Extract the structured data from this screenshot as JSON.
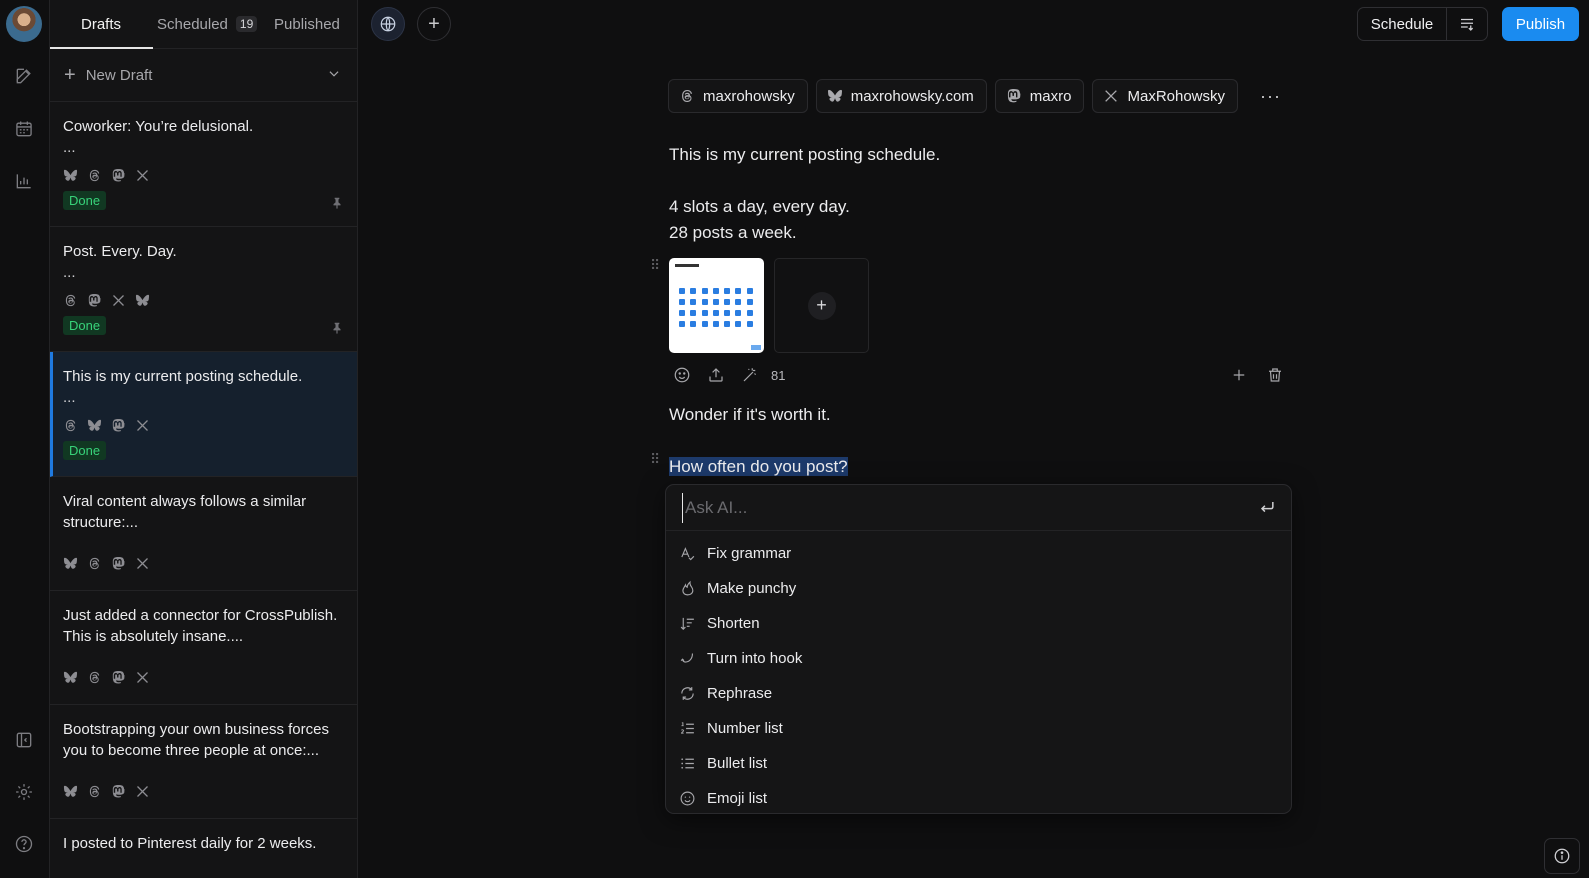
{
  "tabs": [
    {
      "label": "Drafts"
    },
    {
      "label": "Scheduled",
      "count": "19"
    },
    {
      "label": "Published"
    }
  ],
  "new_draft_label": "New Draft",
  "drafts": [
    {
      "title": "Coworker: You’re delusional.",
      "ellipsis": "...",
      "platforms": [
        "bluesky-icon",
        "threads-icon",
        "mastodon-icon",
        "x-icon"
      ],
      "status": "Done",
      "pinned": true
    },
    {
      "title": "Post. Every. Day.",
      "ellipsis": "...",
      "platforms": [
        "threads-icon",
        "mastodon-icon",
        "x-icon",
        "bluesky-icon"
      ],
      "status": "Done",
      "pinned": true
    },
    {
      "title": "This is my current posting schedule.",
      "ellipsis": "...",
      "platforms": [
        "threads-icon",
        "bluesky-icon",
        "mastodon-icon",
        "x-icon"
      ],
      "status": "Done",
      "pinned": false
    },
    {
      "title": "Viral content always follows a similar structure:...",
      "platforms": [
        "bluesky-icon",
        "threads-icon",
        "mastodon-icon",
        "x-icon"
      ]
    },
    {
      "title": "Just added a connector for CrossPublish. This is absolutely insane....",
      "platforms": [
        "bluesky-icon",
        "threads-icon",
        "mastodon-icon",
        "x-icon"
      ]
    },
    {
      "title": "Bootstrapping your own business forces you to become three people at once:...",
      "platforms": [
        "bluesky-icon",
        "threads-icon",
        "mastodon-icon",
        "x-icon"
      ]
    },
    {
      "title": "I posted to Pinterest daily for 2 weeks."
    }
  ],
  "toolbar": {
    "schedule_label": "Schedule",
    "publish_label": "Publish"
  },
  "accounts": [
    {
      "icon": "threads-icon",
      "name": "maxrohowsky"
    },
    {
      "icon": "bluesky-icon",
      "name": "maxrohowsky.com"
    },
    {
      "icon": "mastodon-icon",
      "name": "maxro"
    },
    {
      "icon": "x-icon",
      "name": "MaxRohowsky"
    }
  ],
  "more_label": "···",
  "editor": {
    "line1": "This is my current posting schedule.",
    "line2": "4 slots a day, every day.",
    "line3": "28 posts a week.",
    "char_count": "81",
    "line4": "Wonder if it's worth it.",
    "line5": "How often do you post?"
  },
  "ai": {
    "placeholder": "Ask AI...",
    "actions": [
      {
        "label": "Fix grammar",
        "icon": "spellcheck-icon"
      },
      {
        "label": "Make punchy",
        "icon": "flame-icon"
      },
      {
        "label": "Shorten",
        "icon": "sort-shorten-icon"
      },
      {
        "label": "Turn into hook",
        "icon": "hook-icon"
      },
      {
        "label": "Rephrase",
        "icon": "refresh-icon"
      },
      {
        "label": "Number list",
        "icon": "numbered-list-icon"
      },
      {
        "label": "Bullet list",
        "icon": "bullet-list-icon"
      },
      {
        "label": "Emoji list",
        "icon": "smiley-icon"
      }
    ]
  }
}
